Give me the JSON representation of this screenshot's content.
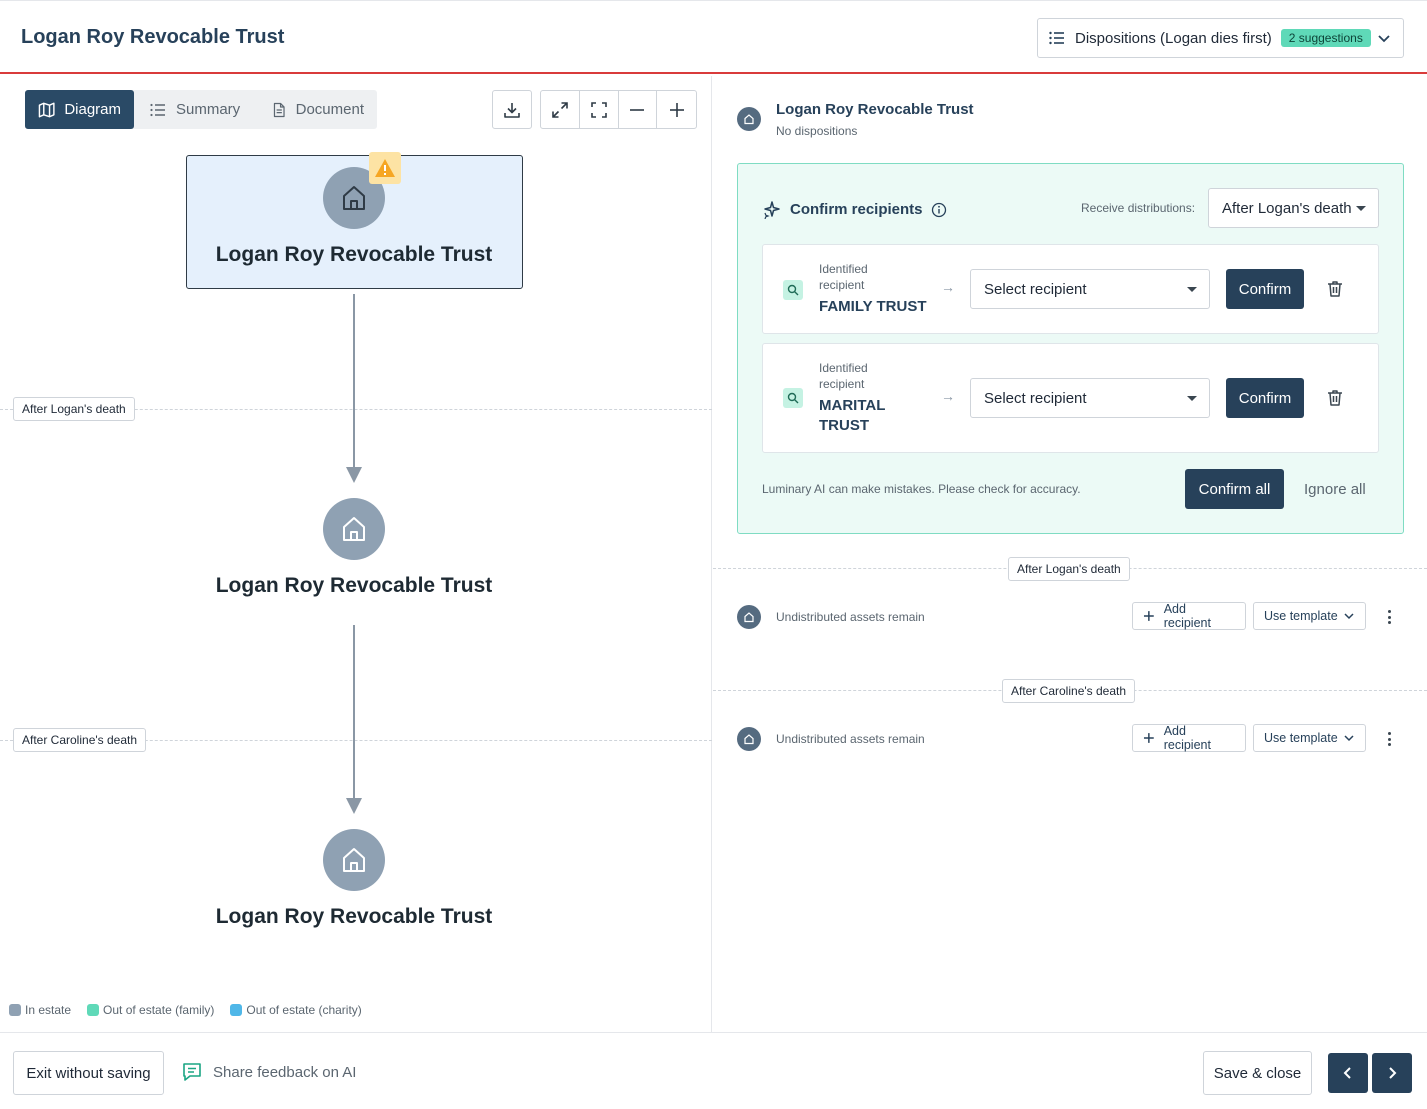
{
  "header": {
    "title": "Logan Roy Revocable Trust",
    "dispositions_select": {
      "value": "Dispositions (Logan dies first)",
      "badge": "2 suggestions"
    }
  },
  "left_panel": {
    "tabs": [
      {
        "label": "Diagram",
        "icon": "map-icon",
        "active": true
      },
      {
        "label": "Summary",
        "icon": "list-icon",
        "active": false
      },
      {
        "label": "Document",
        "icon": "document-icon",
        "active": false
      }
    ],
    "toolbar_icons": [
      "download-icon",
      "expand-icon",
      "fit-screen-icon",
      "zoom-out-icon",
      "zoom-in-icon"
    ],
    "nodes": [
      {
        "label": "Logan Roy Revocable Trust",
        "selected": true,
        "warning": true,
        "icon": "house-icon"
      },
      {
        "label": "Logan Roy Revocable Trust",
        "selected": false,
        "warning": false,
        "icon": "house-icon"
      },
      {
        "label": "Logan Roy Revocable Trust",
        "selected": false,
        "warning": false,
        "icon": "house-icon"
      }
    ],
    "section_labels": [
      "After Logan's death",
      "After Caroline's death"
    ],
    "legend": [
      {
        "label": "In estate",
        "color": "#8fa1b3"
      },
      {
        "label": "Out of estate (family)",
        "color": "#5fd9b8"
      },
      {
        "label": "Out of estate (charity)",
        "color": "#4fb7e8"
      }
    ]
  },
  "right_panel": {
    "entity": {
      "title": "Logan Roy Revocable Trust",
      "subtitle": "No dispositions"
    },
    "ai_box": {
      "title": "Confirm recipients",
      "receive_label": "Receive distributions:",
      "receive_value": "After Logan's death",
      "recipients": [
        {
          "identified_label": "Identified recipient",
          "name": "FAMILY TRUST",
          "select_value": "Select recipient",
          "confirm_label": "Confirm"
        },
        {
          "identified_label": "Identified recipient",
          "name": "MARITAL TRUST",
          "select_value": "Select recipient",
          "confirm_label": "Confirm"
        }
      ],
      "note": "Luminary AI can make mistakes. Please check for accuracy.",
      "confirm_all": "Confirm all",
      "ignore_all": "Ignore all"
    },
    "sections": [
      {
        "label": "After Logan's death",
        "row_text": "Undistributed assets remain",
        "add_label": "Add recipient",
        "template_label": "Use template"
      },
      {
        "label": "After Caroline's death",
        "row_text": "Undistributed assets remain",
        "add_label": "Add recipient",
        "template_label": "Use template"
      }
    ]
  },
  "footer": {
    "exit_label": "Exit without saving",
    "feedback_label": "Share feedback on AI",
    "save_label": "Save & close"
  },
  "colors": {
    "primary": "#27415a",
    "accent_teal": "#5fd9b8",
    "header_border": "#d93b3b",
    "warning": "#f6a623"
  }
}
